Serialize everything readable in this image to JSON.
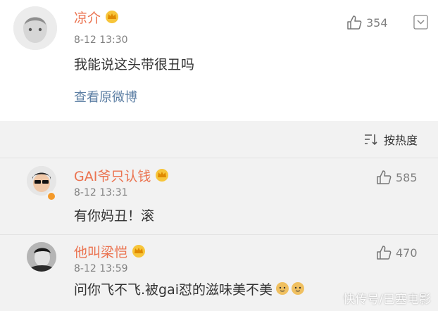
{
  "post": {
    "author": "凉介",
    "timestamp": "8-12 13:30",
    "text": "我能说这头带很丑吗",
    "view_original": "查看原微博",
    "likes": "354",
    "icons": {
      "like": "thumbs-up-icon",
      "more": "chevron-down-icon",
      "badge": "vip-crown-icon"
    }
  },
  "replies_section": {
    "sort_label": "按热度",
    "sort_icon": "sort-icon",
    "items": [
      {
        "author": "GAI爷只认钱",
        "timestamp": "8-12 13:31",
        "text": "有你妈丑！滚",
        "likes": "585"
      },
      {
        "author": "他叫梁恺",
        "timestamp": "8-12 13:59",
        "text": "问你飞不飞.被gai怼的滋味美不美",
        "likes": "470"
      }
    ]
  },
  "colors": {
    "username": "#eb7350",
    "link": "#5d7fa4",
    "meta": "#808080",
    "reply_bg": "#f2f2f2"
  },
  "watermark": "快传号/巴塞电影"
}
